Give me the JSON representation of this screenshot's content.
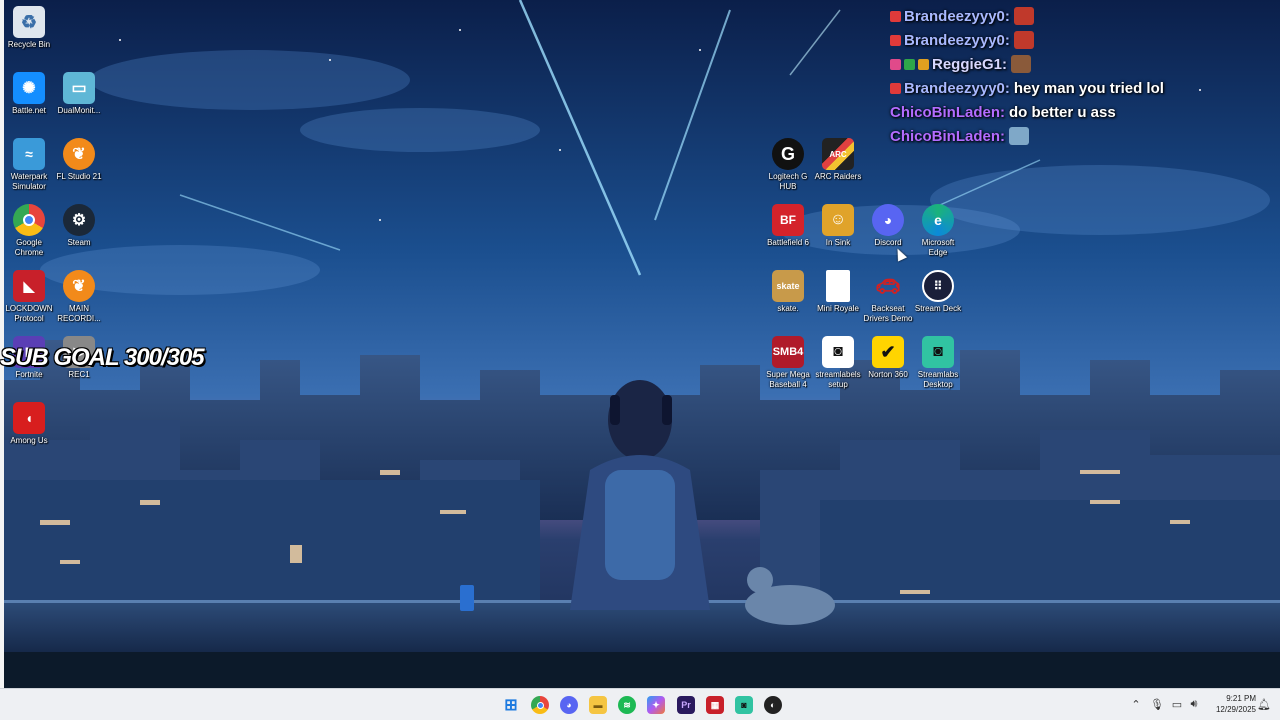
{
  "desktop": {
    "icons_left": [
      {
        "label": "Recycle Bin",
        "color": "#dfe6ee"
      },
      {
        "label": "Battle.net",
        "color": "#148eff"
      },
      {
        "label": "DualMonit...",
        "color": "#5fb7d6"
      },
      {
        "label": "Waterpark Simulator",
        "color": "#3a9ad9"
      },
      {
        "label": "FL Studio 21",
        "color": "#f28a1a"
      },
      {
        "label": "Google Chrome",
        "color": "#e8453c"
      },
      {
        "label": "Steam",
        "color": "#1b2838"
      },
      {
        "label": "LOCKDOWN Protocol",
        "color": "#c8202a"
      },
      {
        "label": "MAIN RECORDI...",
        "color": "#f28a1a"
      },
      {
        "label": "Fortnite",
        "color": "#5a3fb5"
      },
      {
        "label": "REC1",
        "color": "#888888"
      },
      {
        "label": "Among Us",
        "color": "#d81e1e"
      }
    ],
    "icons_right": [
      {
        "label": "Logitech G HUB",
        "color": "#111111"
      },
      {
        "label": "ARC Raiders",
        "color": "#222222"
      },
      {
        "label": "Battlefield 6",
        "color": "#d4232b"
      },
      {
        "label": "In Sink",
        "color": "#e0a32a"
      },
      {
        "label": "Discord",
        "color": "#5865f2"
      },
      {
        "label": "Microsoft Edge",
        "color": "#1bb37a"
      },
      {
        "label": "skate.",
        "color": "#c89a4a"
      },
      {
        "label": "Mini Royale",
        "color": "#ffffff"
      },
      {
        "label": "Backseat Drivers Demo",
        "color": "#d42020"
      },
      {
        "label": "Stream Deck",
        "color": "#1a1f3a"
      },
      {
        "label": "Super Mega Baseball 4",
        "color": "#b01a2a"
      },
      {
        "label": "streamlabels setup",
        "color": "#ffffff"
      },
      {
        "label": "Norton 360",
        "color": "#ffd400"
      },
      {
        "label": "Streamlabs Desktop",
        "color": "#31c3a2"
      }
    ]
  },
  "chat": {
    "messages": [
      {
        "user": "Brandeezyyy0:",
        "text": "",
        "user_color": "#a8b8ff",
        "badge_color": "#e03a3a",
        "has_emote": true,
        "emote_color": "#c0392b"
      },
      {
        "user": "Brandeezyyy0:",
        "text": "",
        "user_color": "#a8b8ff",
        "badge_color": "#e03a3a",
        "has_emote": true,
        "emote_color": "#c0392b"
      },
      {
        "user": "ReggieG1:",
        "text": "",
        "user_color": "#d8d8ff",
        "badge_color": "#e04a8a",
        "has_emote": true,
        "emote_color": "#8a5a3a"
      },
      {
        "user": "Brandeezyyy0:",
        "text": "hey man you tried lol",
        "user_color": "#a8b8ff",
        "badge_color": "#e03a3a",
        "has_emote": false,
        "emote_color": ""
      },
      {
        "user": "ChicoBinLaden:",
        "text": "do better u ass",
        "user_color": "#b36cff",
        "badge_color": "",
        "has_emote": false,
        "emote_color": ""
      },
      {
        "user": "ChicoBinLaden:",
        "text": "",
        "user_color": "#b36cff",
        "badge_color": "",
        "has_emote": true,
        "emote_color": "#7fa8c8"
      }
    ]
  },
  "overlay": {
    "sub_goal": "SUB GOAL 300/305"
  },
  "taskbar": {
    "apps": [
      {
        "name": "start-button",
        "glyph": "⊞",
        "color": "#1e7be0"
      },
      {
        "name": "chrome",
        "glyph": "●",
        "color": "#e8453c"
      },
      {
        "name": "discord",
        "glyph": "◎",
        "color": "#5865f2"
      },
      {
        "name": "file-explorer",
        "glyph": "▬",
        "color": "#f5c542"
      },
      {
        "name": "spotify",
        "glyph": "≋",
        "color": "#1db954"
      },
      {
        "name": "copilot",
        "glyph": "✦",
        "color": "#7a5af8"
      },
      {
        "name": "premiere-pro",
        "glyph": "Pr",
        "color": "#2a1a5e"
      },
      {
        "name": "video-app",
        "glyph": "▦",
        "color": "#c8202a"
      },
      {
        "name": "streamlabs",
        "glyph": "◉",
        "color": "#31c3a2"
      },
      {
        "name": "obs",
        "glyph": "◐",
        "color": "#222222"
      }
    ],
    "time": "9:21 PM",
    "date": "12/29/2025"
  }
}
